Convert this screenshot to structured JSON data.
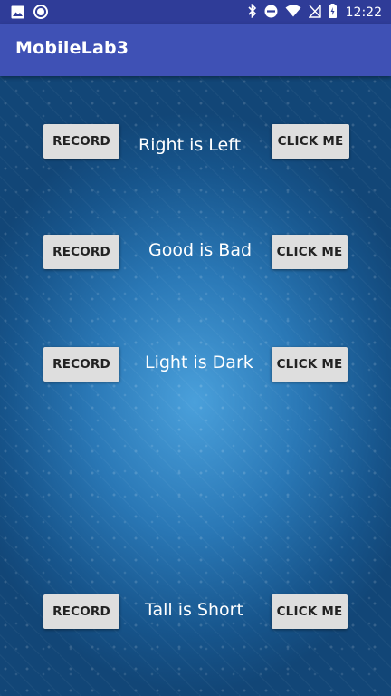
{
  "status_bar": {
    "time": "12:22",
    "icons": [
      "image-icon",
      "circle-notification-icon",
      "bluetooth-icon",
      "do-not-disturb-icon",
      "wifi-icon",
      "no-sim-icon",
      "battery-charging-icon"
    ]
  },
  "app_bar": {
    "title": "MobileLab3"
  },
  "rows": [
    {
      "record_label": "RECORD",
      "text": "Right is Left",
      "click_label": "CLICK ME"
    },
    {
      "record_label": "RECORD",
      "text": "Good is Bad",
      "click_label": "CLICK ME"
    },
    {
      "record_label": "RECORD",
      "text": "Light is Dark",
      "click_label": "CLICK ME"
    },
    {
      "record_label": "RECORD",
      "text": "Tall is Short",
      "click_label": "CLICK ME"
    }
  ],
  "colors": {
    "status_bar": "#2f3c98",
    "app_bar": "#3f51b5",
    "button": "#dedede",
    "background": "#1a5a8e"
  }
}
